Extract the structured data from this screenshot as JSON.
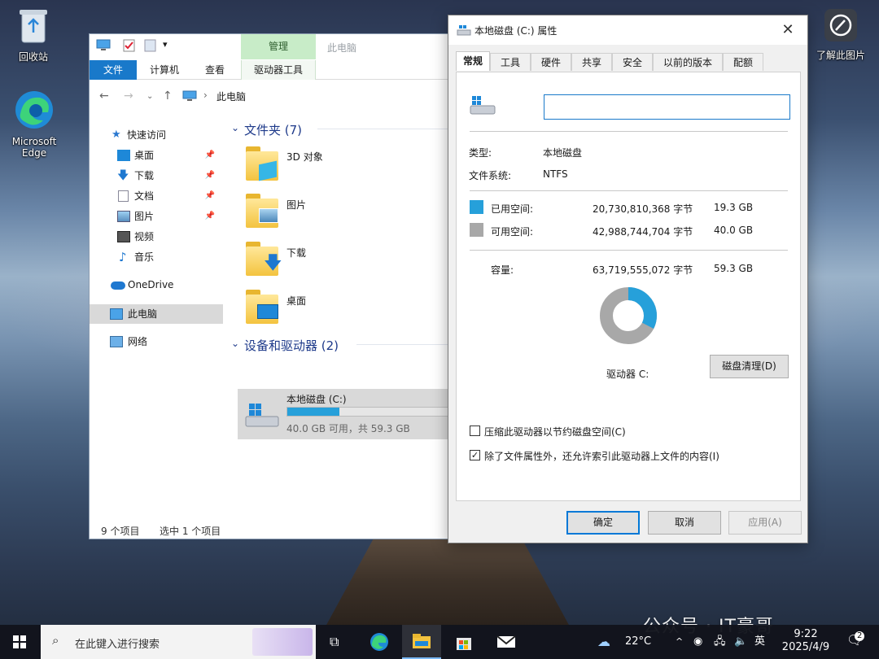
{
  "desktop": {
    "icons": [
      {
        "label": "回收站"
      },
      {
        "label": "Microsoft Edge"
      },
      {
        "label": "了解此图片"
      }
    ]
  },
  "explorer": {
    "context_tab": "管理",
    "title": "此电脑",
    "ribbon_tabs": [
      "文件",
      "计算机",
      "查看",
      "驱动器工具"
    ],
    "address": "此电脑",
    "nav": {
      "quick_access": "快速访问",
      "items": [
        "桌面",
        "下载",
        "文档",
        "图片",
        "视频",
        "音乐"
      ],
      "onedrive": "OneDrive",
      "this_pc": "此电脑",
      "network": "网络"
    },
    "folders_header": "文件夹 (7)",
    "folders": [
      "3D 对象",
      "图片",
      "下载",
      "桌面"
    ],
    "devices_header": "设备和驱动器 (2)",
    "drive": {
      "name": "本地磁盘 (C:)",
      "summary": "40.0 GB 可用，共 59.3 GB",
      "used_fraction": 0.325
    },
    "status_items": "9 个项目",
    "status_selected": "选中 1 个项目"
  },
  "dialog": {
    "title": "本地磁盘 (C:) 属性",
    "tabs": [
      "常规",
      "工具",
      "硬件",
      "共享",
      "安全",
      "以前的版本",
      "配额"
    ],
    "name_value": "",
    "type_label": "类型:",
    "type_value": "本地磁盘",
    "fs_label": "文件系统:",
    "fs_value": "NTFS",
    "used_label": "已用空间:",
    "used_bytes": "20,730,810,368 字节",
    "used_gb": "19.3 GB",
    "free_label": "可用空间:",
    "free_bytes": "42,988,744,704 字节",
    "free_gb": "40.0 GB",
    "cap_label": "容量:",
    "cap_bytes": "63,719,555,072 字节",
    "cap_gb": "59.3 GB",
    "drive_label": "驱动器 C:",
    "cleanup_btn": "磁盘清理(D)",
    "compress_label": "压缩此驱动器以节约磁盘空间(C)",
    "compress_checked": false,
    "index_label": "除了文件属性外，还允许索引此驱动器上文件的内容(I)",
    "index_checked": true,
    "ok": "确定",
    "cancel": "取消",
    "apply": "应用(A)",
    "used_fraction": 0.325,
    "colors": {
      "used": "#26a0da",
      "free": "#a8a8a8"
    }
  },
  "taskbar": {
    "search_placeholder": "在此键入进行搜索",
    "weather": "22°C",
    "ime": "英",
    "time": "9:22",
    "date": "2025/4/9",
    "notification_count": "2"
  },
  "watermark": "公众号 · IT豪哥"
}
